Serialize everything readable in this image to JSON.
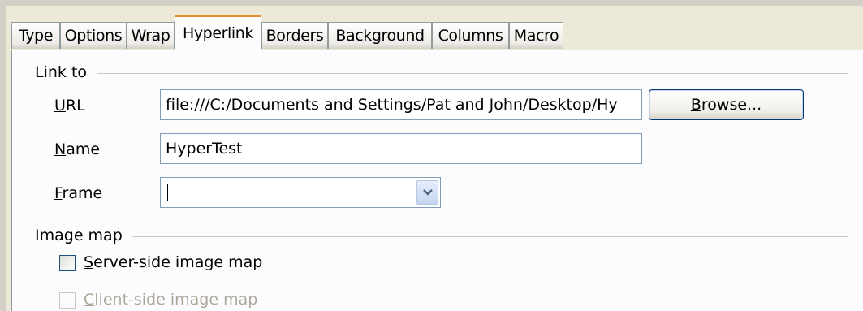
{
  "tabs": [
    "Type",
    "Options",
    "Wrap",
    "Hyperlink",
    "Borders",
    "Background",
    "Columns",
    "Macro"
  ],
  "active_tab": "Hyperlink",
  "link_to": {
    "legend": "Link to",
    "url_label_u": "U",
    "url_label_rest": "RL",
    "url_value": "file:///C:/Documents and Settings/Pat and John/Desktop/Hy",
    "browse_u": "B",
    "browse_rest": "rowse...",
    "name_label_u": "N",
    "name_label_rest": "ame",
    "name_value": "HyperTest",
    "frame_label_u": "F",
    "frame_label_rest": "rame",
    "frame_value": ""
  },
  "image_map": {
    "legend": "Image map",
    "server_u": "S",
    "server_rest": "erver-side image map",
    "server_checked": false,
    "client_u": "C",
    "client_rest": "lient-side image map",
    "client_checked": false,
    "client_enabled": false
  }
}
